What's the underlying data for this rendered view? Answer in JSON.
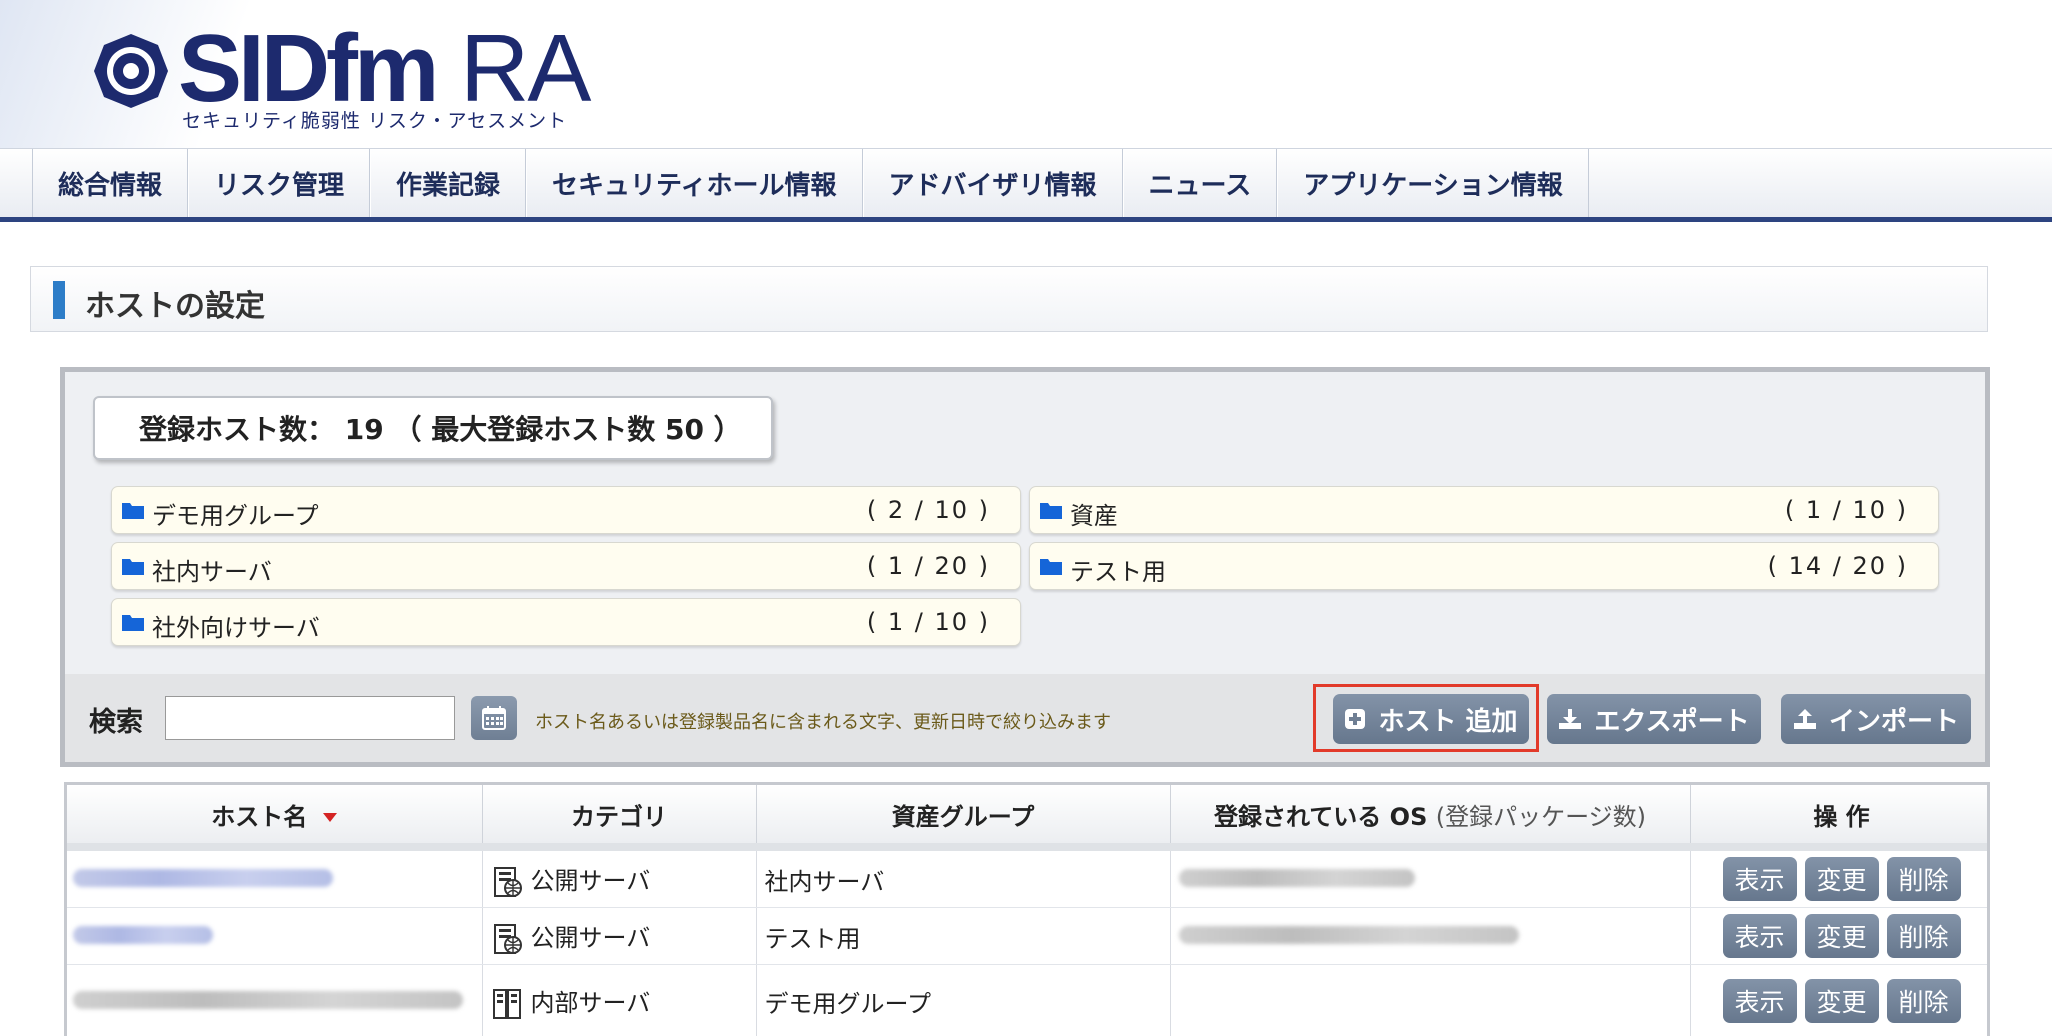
{
  "logo": {
    "name": "SIDfm",
    "suffix": "RA",
    "subtitle": "セキュリティ脆弱性 リスク・アセスメント"
  },
  "nav": [
    "総合情報",
    "リスク管理",
    "作業記録",
    "セキュリティホール情報",
    "アドバイザリ情報",
    "ニュース",
    "アプリケーション情報"
  ],
  "page_title": "ホストの設定",
  "host_count": "登録ホスト数： 19 （ 最大登録ホスト数 50 ）",
  "groups": [
    {
      "name": "デモ用グループ",
      "count": "( 2 / 10 )"
    },
    {
      "name": "資産",
      "count": "( 1 / 10 )"
    },
    {
      "name": "社内サーバ",
      "count": "( 1 / 20 )"
    },
    {
      "name": "テスト用",
      "count": "( 14 / 20 )"
    },
    {
      "name": "社外向けサーバ",
      "count": "( 1 / 10 )"
    }
  ],
  "search": {
    "label": "検索",
    "value": "",
    "hint": "ホスト名あるいは登録製品名に含まれる文字、更新日時で絞り込みます"
  },
  "buttons": {
    "add_host": "ホスト 追加",
    "export": "エクスポート",
    "import": "インポート"
  },
  "table": {
    "headers": {
      "host": "ホスト名",
      "category": "カテゴリ",
      "group": "資産グループ",
      "os": "登録されている OS",
      "os_sub": "(登録パッケージ数)",
      "ops": "操 作"
    },
    "rows": [
      {
        "category": "公開サーバ",
        "category_icon": "public-server-icon",
        "group": "社内サーバ"
      },
      {
        "category": "公開サーバ",
        "category_icon": "public-server-icon",
        "group": "テスト用"
      },
      {
        "category": "内部サーバ",
        "category_icon": "internal-server-icon",
        "group": "デモ用グループ"
      }
    ],
    "actions": {
      "view": "表示",
      "edit": "変更",
      "delete": "削除"
    }
  },
  "colors": {
    "accent": "#2d4480",
    "button": "#6f7f94",
    "highlight": "#e23a2a",
    "title_bar": "#2d7dc8"
  }
}
